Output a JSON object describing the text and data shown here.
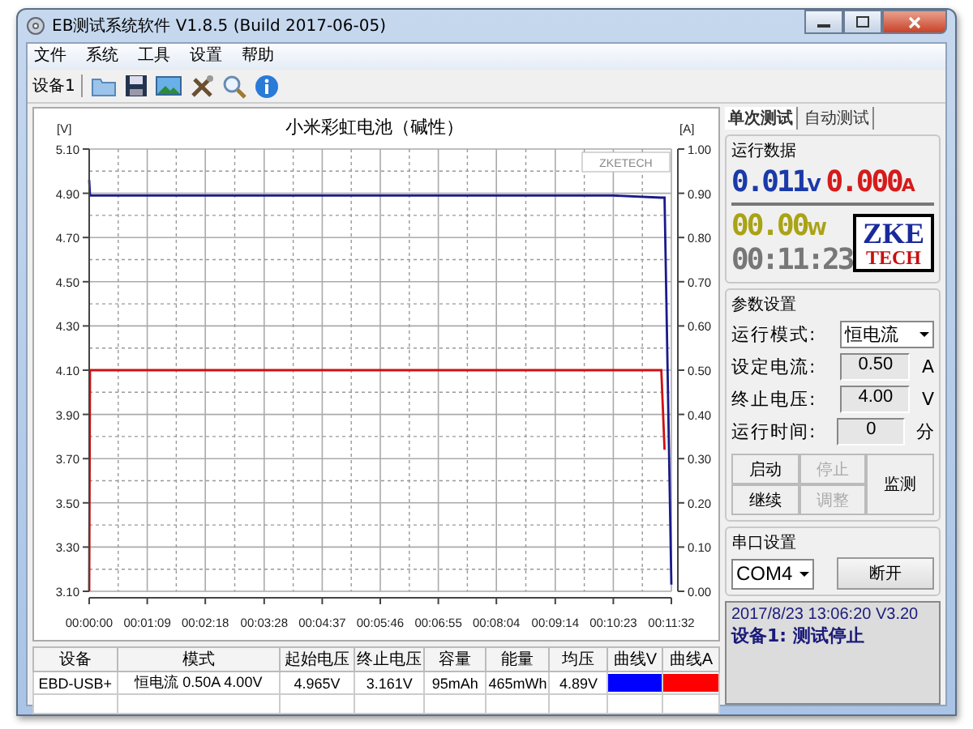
{
  "window": {
    "title": "EB测试系统软件 V1.8.5 (Build 2017-06-05)"
  },
  "menu": [
    "文件",
    "系统",
    "工具",
    "设置",
    "帮助"
  ],
  "toolbar": {
    "device_label": "设备1"
  },
  "chart": {
    "watermark": "ZKETECH",
    "chart_data": {
      "type": "line",
      "title": "小米彩虹电池（碱性）",
      "x": [
        0,
        1,
        69,
        138,
        208,
        277,
        346,
        415,
        484,
        554,
        623,
        680,
        684,
        692
      ],
      "ylabel": "[V]",
      "y2label": "[A]",
      "grid": true,
      "xlim": [
        0,
        692
      ],
      "ylim": [
        3.1,
        5.1
      ],
      "y2lim": [
        0,
        1
      ],
      "xticks": [
        {
          "value": 0,
          "label": "00:00:00"
        },
        {
          "value": 69,
          "label": "00:01:09"
        },
        {
          "value": 138,
          "label": "00:02:18"
        },
        {
          "value": 208,
          "label": "00:03:28"
        },
        {
          "value": 277,
          "label": "00:04:37"
        },
        {
          "value": 346,
          "label": "00:05:46"
        },
        {
          "value": 415,
          "label": "00:06:55"
        },
        {
          "value": 484,
          "label": "00:08:04"
        },
        {
          "value": 554,
          "label": "00:09:14"
        },
        {
          "value": 623,
          "label": "00:10:23"
        },
        {
          "value": 692,
          "label": "00:11:32"
        }
      ],
      "yticks": [
        {
          "value": 5.1,
          "label": "5.10"
        },
        {
          "value": 4.9,
          "label": "4.90"
        },
        {
          "value": 4.7,
          "label": "4.70"
        },
        {
          "value": 4.5,
          "label": "4.50"
        },
        {
          "value": 4.3,
          "label": "4.30"
        },
        {
          "value": 4.1,
          "label": "4.10"
        },
        {
          "value": 3.9,
          "label": "3.90"
        },
        {
          "value": 3.7,
          "label": "3.70"
        },
        {
          "value": 3.5,
          "label": "3.50"
        },
        {
          "value": 3.3,
          "label": "3.30"
        },
        {
          "value": 3.1,
          "label": "3.10"
        }
      ],
      "y2ticks": [
        {
          "value": 1,
          "label": "1.00"
        },
        {
          "value": 0.9,
          "label": "0.90"
        },
        {
          "value": 0.8,
          "label": "0.80"
        },
        {
          "value": 0.7,
          "label": "0.70"
        },
        {
          "value": 0.6,
          "label": "0.60"
        },
        {
          "value": 0.5,
          "label": "0.50"
        },
        {
          "value": 0.4,
          "label": "0.40"
        },
        {
          "value": 0.3,
          "label": "0.30"
        },
        {
          "value": 0.2,
          "label": "0.20"
        },
        {
          "value": 0.1,
          "label": "0.10"
        },
        {
          "value": 0,
          "label": "0.00"
        }
      ],
      "series": [
        {
          "color": "#1a1a8c",
          "values": [
            4.96,
            4.89,
            4.89,
            4.89,
            4.89,
            4.89,
            4.89,
            4.89,
            4.89,
            4.89,
            4.89,
            4.88,
            4.88,
            3.13
          ]
        },
        {
          "color": "#d01010",
          "axis": "y2",
          "values": [
            0,
            0.5,
            0.5,
            0.5,
            0.5,
            0.5,
            0.5,
            0.5,
            0.5,
            0.5,
            0.5,
            0.5,
            0.32,
            null
          ]
        }
      ]
    }
  },
  "table": {
    "columns": [
      "设备",
      "模式",
      "起始电压",
      "终止电压",
      "容量",
      "能量",
      "均压",
      "曲线V",
      "曲线A"
    ],
    "rows": [
      {
        "cells": [
          "EBD-USB+",
          "恒电流  0.50A  4.00V",
          "4.965V",
          "3.161V",
          "95mAh",
          "465mWh",
          "4.89V"
        ],
        "swatches": [
          {
            "color": "#0000ff"
          },
          {
            "color": "#ff0000"
          }
        ]
      }
    ]
  },
  "tabs": [
    {
      "label": "单次测试",
      "selected": true
    },
    {
      "label": "自动测试",
      "selected": false
    }
  ],
  "run_data": {
    "title": "运行数据",
    "voltage": "0.011",
    "voltage_unit": "V",
    "current": "0.000",
    "current_unit": "A",
    "power": "00.00",
    "power_unit": "W",
    "time": "00:11:23",
    "logo_top": "ZKE",
    "logo_bottom": "TECH"
  },
  "params": {
    "title": "参数设置",
    "fields": [
      {
        "kind": "select",
        "label": "运行模式:",
        "value": "恒电流"
      },
      {
        "kind": "number",
        "label": "设定电流:",
        "value": "0.50",
        "unit": "A"
      },
      {
        "kind": "number",
        "label": "终止电压:",
        "value": "4.00",
        "unit": "V"
      },
      {
        "kind": "number",
        "label": "运行时间:",
        "value": "0",
        "unit": "分"
      }
    ]
  },
  "buttons": [
    {
      "label": "启动",
      "disabled": false
    },
    {
      "label": "停止",
      "disabled": true
    },
    {
      "label": "监测",
      "disabled": false
    },
    {
      "label": "继续",
      "disabled": false
    },
    {
      "label": "调整",
      "disabled": true
    }
  ],
  "serial": {
    "title": "串口设置",
    "port": "COM4",
    "button": "断开"
  },
  "status": {
    "line1": "2017/8/23 13:06:20  V3.20",
    "line2": "设备1: 测试停止"
  }
}
